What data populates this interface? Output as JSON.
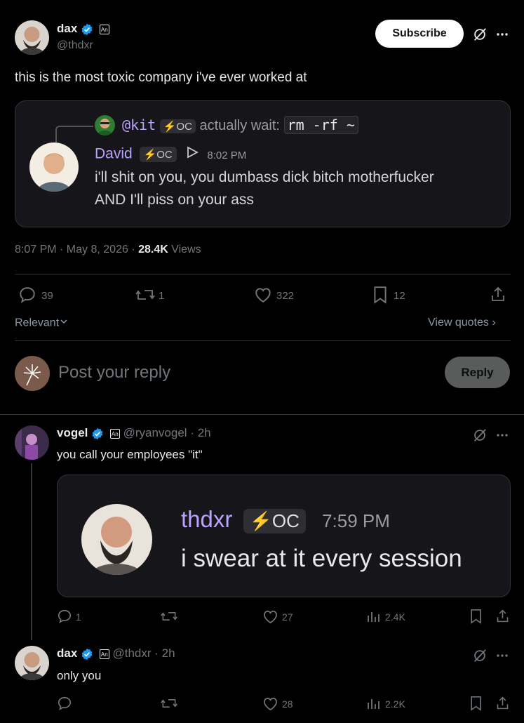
{
  "main_tweet": {
    "author": {
      "name": "dax",
      "handle": "@thdxr",
      "badge": "An"
    },
    "subscribe_label": "Subscribe",
    "text": "this is the most toxic company i've ever worked at",
    "quoted_chat": {
      "reply_handle": "@kit",
      "reply_tag": "OC",
      "reply_text": "actually wait:",
      "reply_code": "rm -rf ~",
      "author": "David",
      "author_tag": "OC",
      "time": "8:02 PM",
      "line1": "i'll shit on you, you dumbass dick bitch motherfucker",
      "line2": "AND I'll piss on your ass"
    },
    "meta": {
      "time_date": "8:07 PM · May 8, 2026 · ",
      "views_count": "28.4K",
      "views_label": " Views"
    },
    "stats": {
      "replies": "39",
      "reposts": "1",
      "likes": "322",
      "bookmarks": "12"
    },
    "sort_label": "Relevant",
    "view_quotes_label": "View quotes"
  },
  "reply_box": {
    "placeholder": "Post your reply",
    "button_label": "Reply"
  },
  "replies": [
    {
      "name": "vogel",
      "badge": "An",
      "handle": "@ryanvogel",
      "time": "· 2h",
      "text": "you call your employees \"it\"",
      "image": {
        "author": "thdxr",
        "tag": "OC",
        "time": "7:59 PM",
        "message": "i swear at it every session"
      },
      "stats": {
        "replies": "1",
        "reposts": "",
        "likes": "27",
        "views": "2.4K"
      }
    },
    {
      "name": "dax",
      "badge": "An",
      "handle": "@thdxr",
      "time": "· 2h",
      "text": "only you",
      "stats": {
        "replies": "",
        "reposts": "",
        "likes": "28",
        "views": "2.2K"
      }
    }
  ],
  "colors": {
    "accent": "#1d9bf0",
    "chat_bg": "#16161a",
    "chat_name": "#b9a3ff",
    "border": "#2f3336"
  }
}
